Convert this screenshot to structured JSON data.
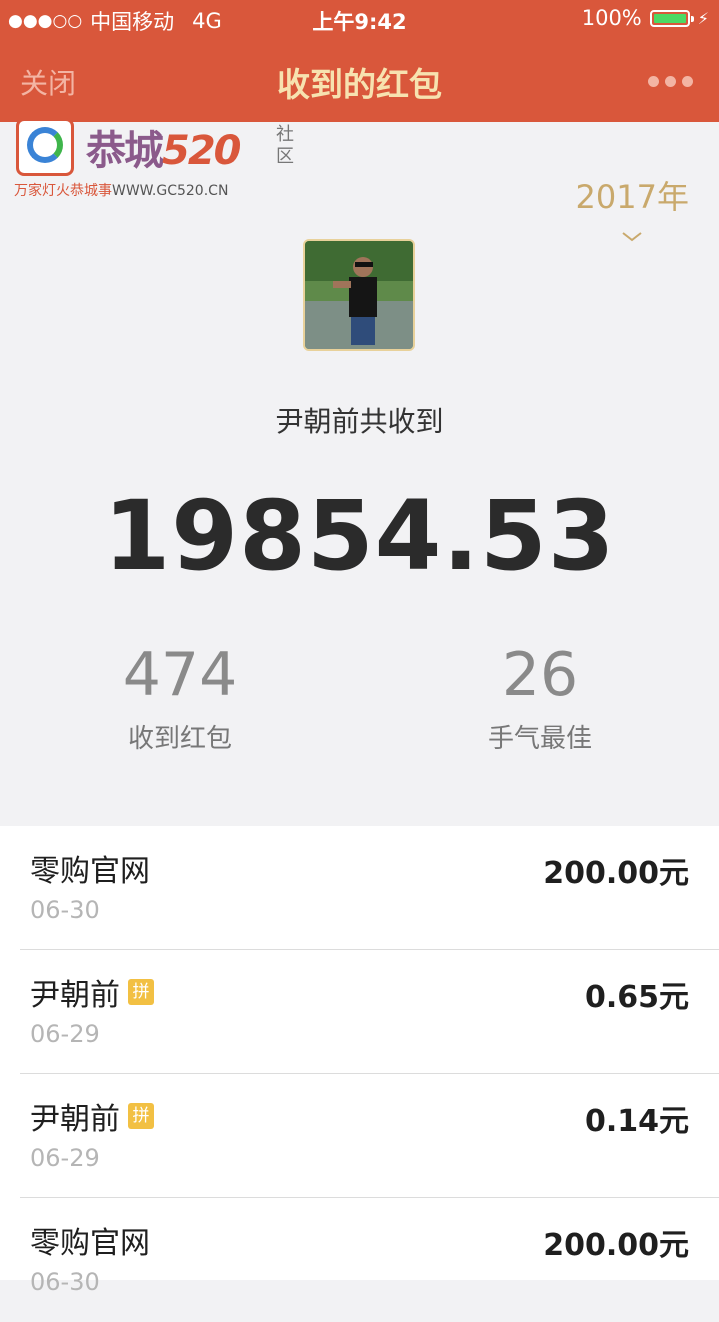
{
  "status_bar": {
    "signal": "●●●○○",
    "carrier": "中国移动",
    "network": "4G",
    "time": "上午9:42",
    "battery": "100%"
  },
  "nav": {
    "close_label": "关闭",
    "title": "收到的红包"
  },
  "watermark": {
    "brand": "恭城",
    "brand_num": "520",
    "side_text": "社区",
    "slogan": "万家灯火恭城事",
    "url": "WWW.GC520.CN"
  },
  "summary": {
    "year": "2017年",
    "label": "尹朝前共收到",
    "total": "19854.53",
    "received_count": "474",
    "received_label": "收到红包",
    "best_count": "26",
    "best_label": "手气最佳"
  },
  "records": [
    {
      "name": "零购官网",
      "badge": "",
      "date": "06-30",
      "amount": "200.00元"
    },
    {
      "name": "尹朝前",
      "badge": "拼",
      "date": "06-29",
      "amount": "0.65元"
    },
    {
      "name": "尹朝前",
      "badge": "拼",
      "date": "06-29",
      "amount": "0.14元"
    },
    {
      "name": "零购官网",
      "badge": "",
      "date": "06-30",
      "amount": "200.00元"
    }
  ],
  "colors": {
    "header_bg": "#d9573b",
    "title_color": "#f7e2b0",
    "year_color": "#c9a96c",
    "badge_color": "#f2c043"
  }
}
